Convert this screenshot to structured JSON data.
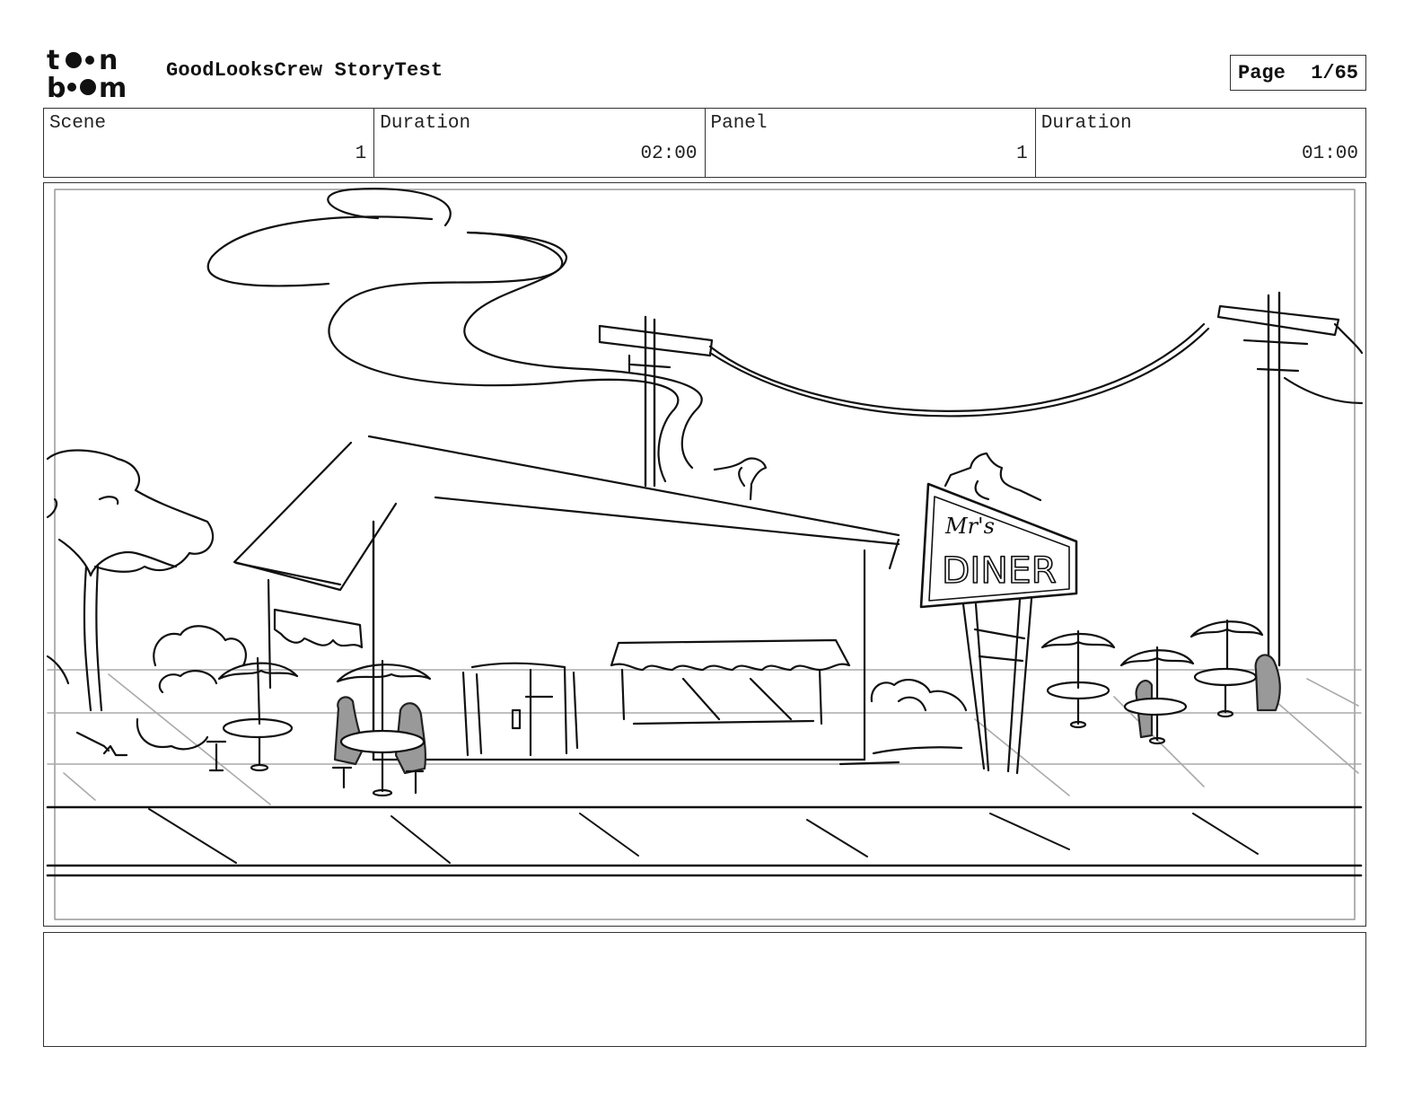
{
  "header": {
    "logo_icon": "toon-boom-logo",
    "logo_lines": [
      "toon",
      "boom"
    ],
    "project_title": "GoodLooksCrew StoryTest",
    "page_label": "Page",
    "page_number": "1/65"
  },
  "info": {
    "scene_label": "Scene",
    "scene_value": "1",
    "scene_duration_label": "Duration",
    "scene_duration_value": "02:00",
    "panel_label": "Panel",
    "panel_value": "1",
    "panel_duration_label": "Duration",
    "panel_duration_value": "01:00"
  },
  "panel": {
    "sign_line1": "Mr's",
    "sign_line2": "DINER"
  },
  "notes": {
    "text": ""
  }
}
